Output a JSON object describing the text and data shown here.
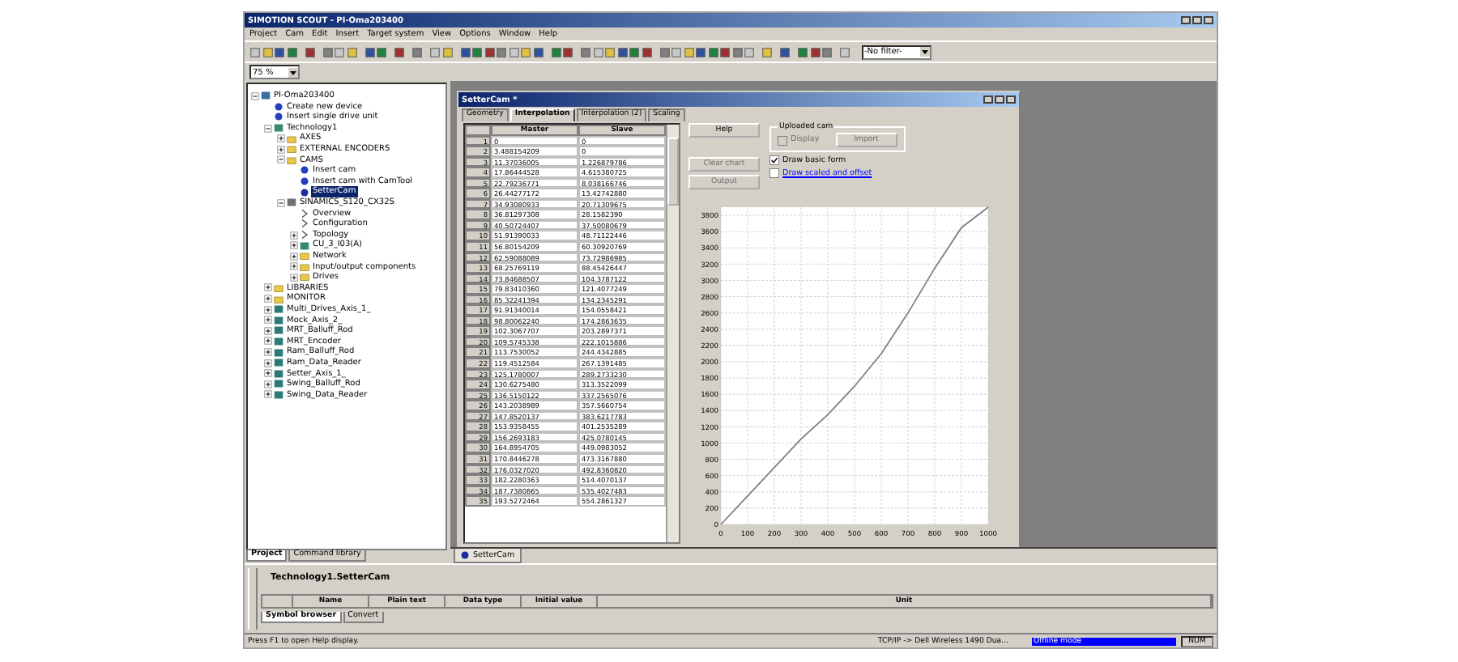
{
  "window": {
    "title": "SIMOTION SCOUT - PI-Oma203400"
  },
  "menu": [
    "Project",
    "Cam",
    "Edit",
    "Insert",
    "Target system",
    "View",
    "Options",
    "Window",
    "Help"
  ],
  "toolbar": {
    "filter": "-No filter-",
    "zoom": "75 %"
  },
  "tree": {
    "items": [
      {
        "label": "PI-Oma203400",
        "kind": "project",
        "expanded": true,
        "selected": false,
        "children": [
          {
            "label": "Create new device",
            "kind": "device",
            "selected": false
          },
          {
            "label": "Insert single drive unit",
            "kind": "device",
            "selected": false
          },
          {
            "label": "Technology1",
            "kind": "module",
            "expanded": true,
            "selected": false,
            "children": [
              {
                "label": "AXES",
                "kind": "folder",
                "expanded": false,
                "selected": false
              },
              {
                "label": "EXTERNAL ENCODERS",
                "kind": "folder",
                "expanded": false,
                "selected": false
              },
              {
                "label": "CAMS",
                "kind": "folder",
                "expanded": true,
                "selected": false,
                "children": [
                  {
                    "label": "Insert cam",
                    "kind": "device",
                    "selected": false
                  },
                  {
                    "label": "Insert cam with CamTool",
                    "kind": "device",
                    "selected": false
                  },
                  {
                    "label": "SetterCam",
                    "kind": "cam",
                    "selected": true
                  }
                ]
              },
              {
                "label": "SINAMICS_S120_CX32S",
                "kind": "drive",
                "expanded": true,
                "selected": false,
                "children": [
                  {
                    "label": "Overview",
                    "kind": "page",
                    "selected": false
                  },
                  {
                    "label": "Configuration",
                    "kind": "page",
                    "selected": false
                  },
                  {
                    "label": "Topology",
                    "kind": "page",
                    "expanded": false,
                    "selected": false
                  },
                  {
                    "label": "CU_3_I03(A)",
                    "kind": "module",
                    "expanded": false,
                    "selected": false
                  },
                  {
                    "label": "Network",
                    "kind": "folder",
                    "expanded": false,
                    "selected": false
                  },
                  {
                    "label": "Input/output components",
                    "kind": "folder",
                    "expanded": false,
                    "selected": false
                  },
                  {
                    "label": "Drives",
                    "kind": "folder",
                    "expanded": false,
                    "selected": false
                  }
                ]
              }
            ]
          },
          {
            "label": "LIBRARIES",
            "kind": "folder",
            "expanded": false,
            "selected": false
          },
          {
            "label": "MONITOR",
            "kind": "folder",
            "expanded": false,
            "selected": false
          },
          {
            "label": "Multi_Drives_Axis_1_",
            "kind": "axis",
            "expanded": false,
            "selected": false
          },
          {
            "label": "Mock_Axis_2_",
            "kind": "axis",
            "expanded": false,
            "selected": false
          },
          {
            "label": "MRT_Balluff_Rod",
            "kind": "axis",
            "expanded": false,
            "selected": false
          },
          {
            "label": "MRT_Encoder",
            "kind": "axis",
            "expanded": false,
            "selected": false
          },
          {
            "label": "Ram_Balluff_Rod",
            "kind": "axis",
            "expanded": false,
            "selected": false
          },
          {
            "label": "Ram_Data_Reader",
            "kind": "axis",
            "expanded": false,
            "selected": false
          },
          {
            "label": "Setter_Axis_1_",
            "kind": "axis",
            "expanded": false,
            "selected": false
          },
          {
            "label": "Swing_Balluff_Rod",
            "kind": "axis",
            "expanded": false,
            "selected": false
          },
          {
            "label": "Swing_Data_Reader",
            "kind": "axis",
            "expanded": false,
            "selected": false
          }
        ]
      }
    ]
  },
  "left_tabs": [
    {
      "label": "Project",
      "selected": true
    },
    {
      "label": "Command library",
      "selected": false
    }
  ],
  "cam_window": {
    "title": "SetterCam *",
    "tabs": [
      {
        "label": "Geometry",
        "selected": false
      },
      {
        "label": "Interpolation",
        "selected": true
      },
      {
        "label": "Interpolation (2)",
        "selected": false
      },
      {
        "label": "Scaling",
        "selected": false
      }
    ],
    "table": {
      "columns": [
        "Master",
        "Slave"
      ],
      "row_numbers": [
        "1",
        "2",
        "3",
        "4",
        "5",
        "6",
        "7",
        "8",
        "9",
        "10",
        "11",
        "12",
        "13",
        "14",
        "15",
        "16",
        "17",
        "18",
        "19",
        "20",
        "21",
        "22",
        "23",
        "24",
        "25",
        "26",
        "27",
        "28",
        "29",
        "30",
        "31",
        "32",
        "33",
        "34",
        "35"
      ],
      "rows": [
        [
          "0",
          "0"
        ],
        [
          "3.488154209",
          "0"
        ],
        [
          "11.37036005",
          "1.226879786"
        ],
        [
          "17.86444528",
          "4.615380725"
        ],
        [
          "22.79236771",
          "8.038166746"
        ],
        [
          "26.44277172",
          "13.42742880"
        ],
        [
          "34.93080933",
          "20.71309675"
        ],
        [
          "36.81297308",
          "28.1582390"
        ],
        [
          "40.50724407",
          "37.50080679"
        ],
        [
          "51.91390033",
          "48.71122446"
        ],
        [
          "56.80154209",
          "60.30920769"
        ],
        [
          "62.59088089",
          "73.72986985"
        ],
        [
          "68.25769119",
          "88.45426447"
        ],
        [
          "73.84688507",
          "104.3787122"
        ],
        [
          "79.83410360",
          "121.4077249"
        ],
        [
          "85.32241394",
          "134.2345291"
        ],
        [
          "91.91340014",
          "154.0558421"
        ],
        [
          "98.80062240",
          "174.2863635"
        ],
        [
          "102.3067707",
          "203.2897371"
        ],
        [
          "109.5745338",
          "222.1015886"
        ],
        [
          "113.7530052",
          "244.4342885"
        ],
        [
          "119.4512584",
          "267.1391485"
        ],
        [
          "125.1780007",
          "289.2733230"
        ],
        [
          "130.6275480",
          "313.3522099"
        ],
        [
          "136.5150122",
          "337.2565076"
        ],
        [
          "143.2038989",
          "357.5660754"
        ],
        [
          "147.8520137",
          "383.6217783"
        ],
        [
          "153.9358455",
          "401.2535289"
        ],
        [
          "156.2693183",
          "425.0780145"
        ],
        [
          "164.8954705",
          "449.0983052"
        ],
        [
          "170.8446278",
          "473.3167880"
        ],
        [
          "176.0327020",
          "492.8360820"
        ],
        [
          "182.2280363",
          "514.4070137"
        ],
        [
          "187.7380865",
          "535.4027483"
        ],
        [
          "193.5272464",
          "554.2861327"
        ]
      ]
    },
    "buttons": [
      {
        "label": "Help",
        "disabled": false
      },
      {
        "label": "Clear chart",
        "disabled": true
      },
      {
        "label": "Output",
        "disabled": true
      }
    ],
    "uploaded_cam": {
      "title": "Uploaded cam",
      "display": {
        "label": "Display",
        "checked": false,
        "disabled": true
      },
      "button": {
        "label": "Import",
        "disabled": true
      }
    },
    "options": [
      {
        "label": "Draw basic form",
        "checked": true,
        "focused": false
      },
      {
        "label": "Draw scaled and offset",
        "checked": false,
        "focused": true
      }
    ],
    "chart_data": {
      "type": "line",
      "x": [
        0,
        100,
        200,
        300,
        400,
        500,
        600,
        700,
        800,
        900,
        1000
      ],
      "series": [
        {
          "color": "#808080",
          "values": [
            0,
            350,
            700,
            1050,
            1350,
            1700,
            2100,
            2600,
            3150,
            3650,
            3900
          ]
        }
      ],
      "grid": true,
      "xlim": [
        0,
        1000
      ],
      "ylim": [
        0,
        3900
      ],
      "xticks": [
        0,
        100,
        200,
        300,
        400,
        500,
        600,
        700,
        800,
        900,
        1000
      ],
      "yticks": [
        0,
        200,
        400,
        600,
        800,
        1000,
        1200,
        1400,
        1600,
        1800,
        2000,
        2200,
        2400,
        2600,
        2800,
        3000,
        3200,
        3400,
        3600,
        3800
      ]
    }
  },
  "document_tabs": [
    {
      "label": "SetterCam",
      "selected": true
    }
  ],
  "symbol_browser": {
    "title": "Technology1.SetterCam",
    "columns": [
      "Name",
      "Plain text",
      "Data type",
      "Initial value",
      "Unit"
    ],
    "tabs": [
      {
        "label": "Symbol browser",
        "selected": true
      },
      {
        "label": "Convert",
        "selected": false
      }
    ]
  },
  "status_bar": {
    "help": "Press F1 to open Help display.",
    "connection": "TCP/IP -> Dell Wireless 1490 Dua...",
    "mode": "Offline mode",
    "num": "NUM"
  }
}
